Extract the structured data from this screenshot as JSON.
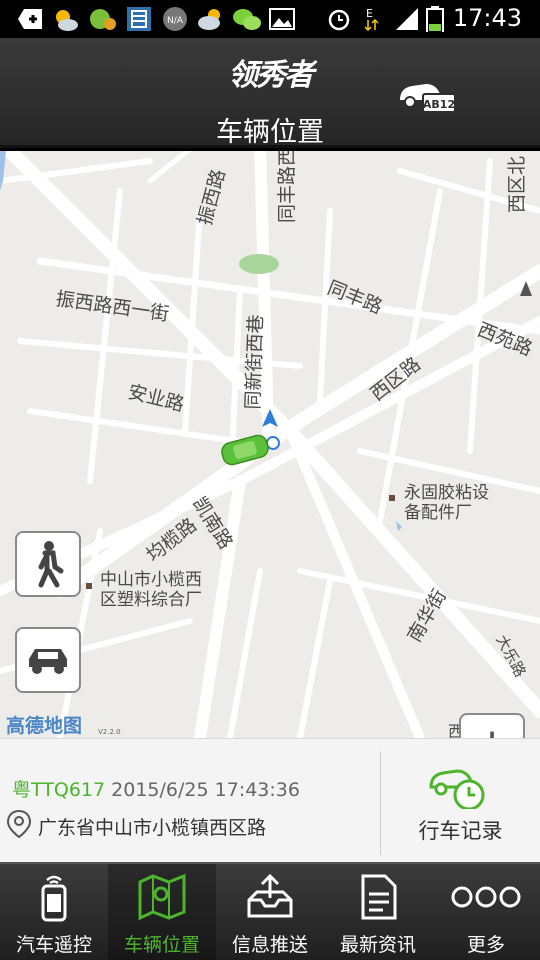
{
  "status_bar": {
    "time": "17:43",
    "na_label": "N/A"
  },
  "header": {
    "logo_text": "领秀者",
    "title": "车辆位置",
    "plate_badge": "AB12"
  },
  "map": {
    "streets": [
      "振西路",
      "同丰路西",
      "同丰路",
      "西区北",
      "振西路西一街",
      "同新街西巷",
      "西苑路",
      "西区路",
      "安业路",
      "均榄路",
      "凯南路",
      "南华街",
      "大乐路",
      "西区一村"
    ],
    "pois": [
      {
        "name": "永固胶粘设备配件厂",
        "line1": "永固胶粘设",
        "line2": "备配件厂"
      },
      {
        "name": "中山市小榄西区塑料综合厂",
        "line1": "中山市小榄西",
        "line2": "区塑料综合厂"
      }
    ],
    "attribution": "高德地图",
    "version": "V2.2.0",
    "zoom_in": "+",
    "zoom_out": "−"
  },
  "vehicle_info": {
    "plate": "粤TTQ617",
    "datetime": "2015/6/25 17:43:36",
    "address": "广东省中山市小榄镇西区路",
    "trip_record_label": "行车记录"
  },
  "nav": {
    "items": [
      {
        "label": "汽车遥控",
        "icon": "phone-remote-icon"
      },
      {
        "label": "车辆位置",
        "icon": "map-location-icon"
      },
      {
        "label": "信息推送",
        "icon": "inbox-upload-icon"
      },
      {
        "label": "最新资讯",
        "icon": "document-icon"
      },
      {
        "label": "更多",
        "icon": "more-dots-icon"
      }
    ],
    "active_index": 1
  },
  "colors": {
    "accent_green": "#4cb52c",
    "header_bg": "#2e2e2e",
    "map_bg": "#eeece8",
    "link_blue": "#4a86c8"
  }
}
